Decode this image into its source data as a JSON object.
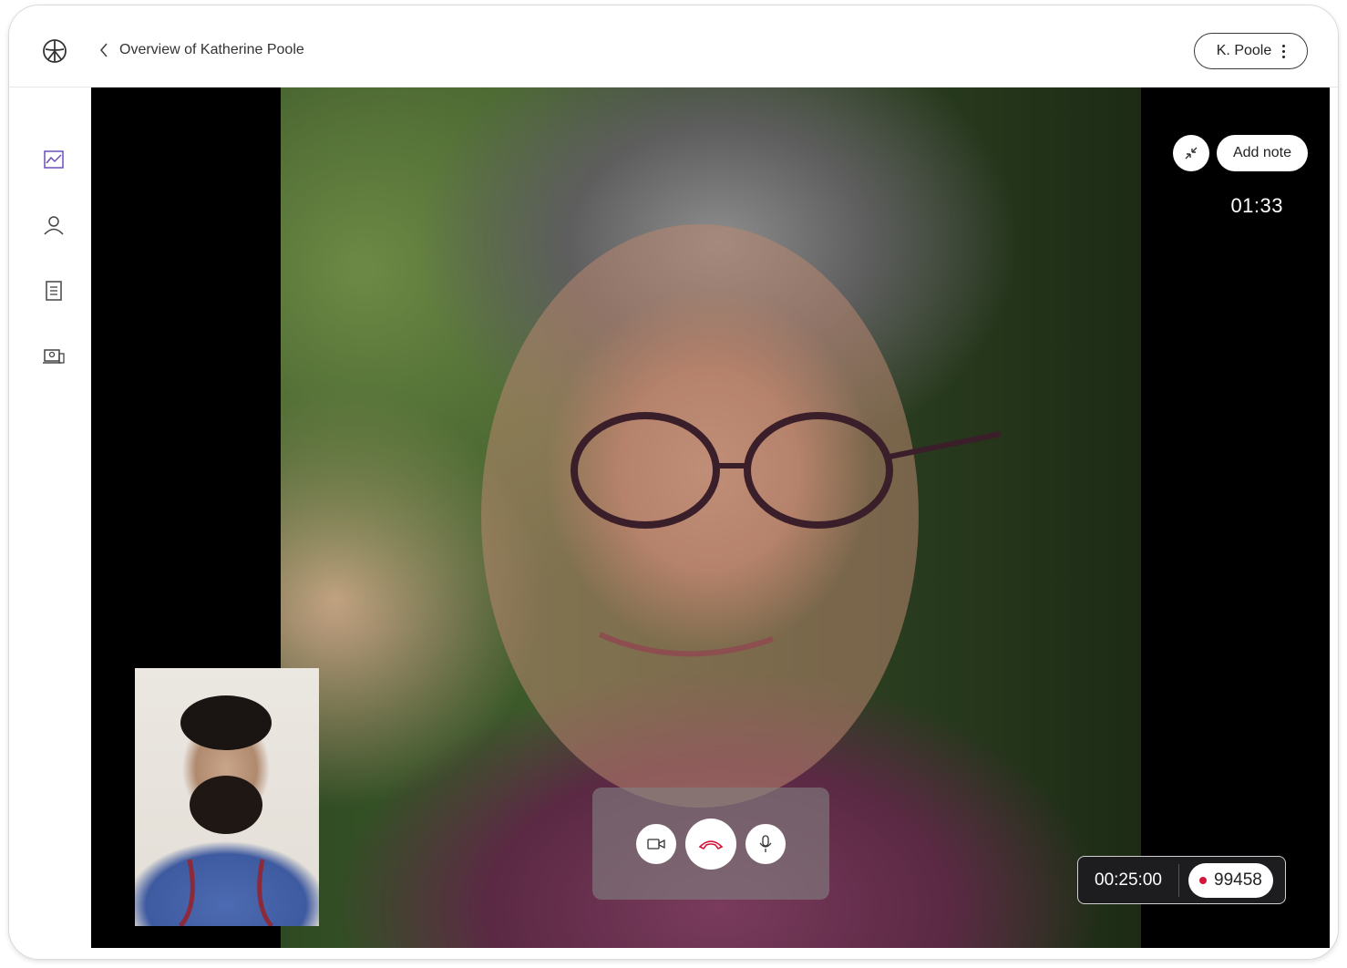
{
  "header": {
    "breadcrumb": "Overview of Katherine Poole",
    "user_label": "K. Poole"
  },
  "sidebar": {
    "items": [
      {
        "icon": "chart-icon",
        "active": true
      },
      {
        "icon": "person-icon",
        "active": false
      },
      {
        "icon": "document-icon",
        "active": false
      },
      {
        "icon": "video-consult-icon",
        "active": false
      }
    ]
  },
  "call": {
    "add_note_label": "Add note",
    "elapsed": "01:33",
    "session_duration": "00:25:00",
    "session_id": "99458"
  },
  "colors": {
    "accent": "#6b4fbb",
    "hangup": "#d4153a",
    "stage_background": "#000000"
  }
}
